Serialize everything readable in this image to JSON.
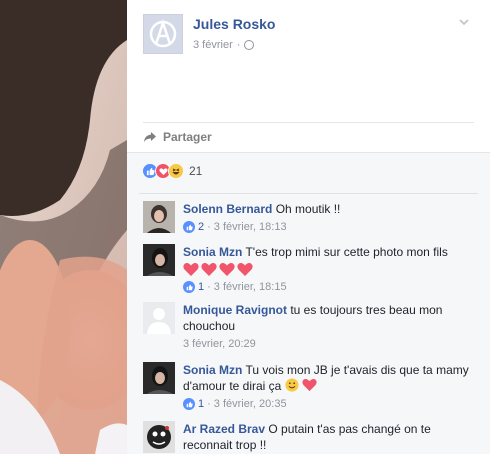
{
  "post": {
    "author": "Jules Rosko",
    "date": "3 février",
    "separator": "·",
    "share_label": "Partager"
  },
  "reactions": {
    "types": [
      "like-icon",
      "love-icon",
      "haha-icon"
    ],
    "count": "21"
  },
  "comments": [
    {
      "name": "Solenn Bernard",
      "text": "Oh moutik !!",
      "likes": "2",
      "timestamp": "3 février, 18:13",
      "sep": "·"
    },
    {
      "name": "Sonia Mzn",
      "text": "T'es trop mimi sur cette photo mon fils",
      "likes": "1",
      "timestamp": "3 février, 18:15",
      "sep": "·",
      "emoji": [
        "heart-icon",
        "heart-icon",
        "heart-icon",
        "heart-icon"
      ]
    },
    {
      "name": "Monique Ravignot",
      "text": "tu es toujours tres beau mon chouchou",
      "timestamp": "3 février, 20:29"
    },
    {
      "name": "Sonia Mzn",
      "text": "Tu vois mon JB je t'avais dis que ta mamy d'amour te dirai ça",
      "likes": "1",
      "timestamp": "3 février, 20:35",
      "sep": "·",
      "emoji": [
        "smile-icon",
        "heart-icon"
      ]
    },
    {
      "name": "Ar Razed Brav",
      "text": "O putain t'as pas changé on te reconnait trop !!"
    }
  ],
  "colors": {
    "link_blue": "#365899",
    "like_blue": "#5890ff",
    "love_red": "#f25268",
    "meta_gray": "#90949c"
  }
}
